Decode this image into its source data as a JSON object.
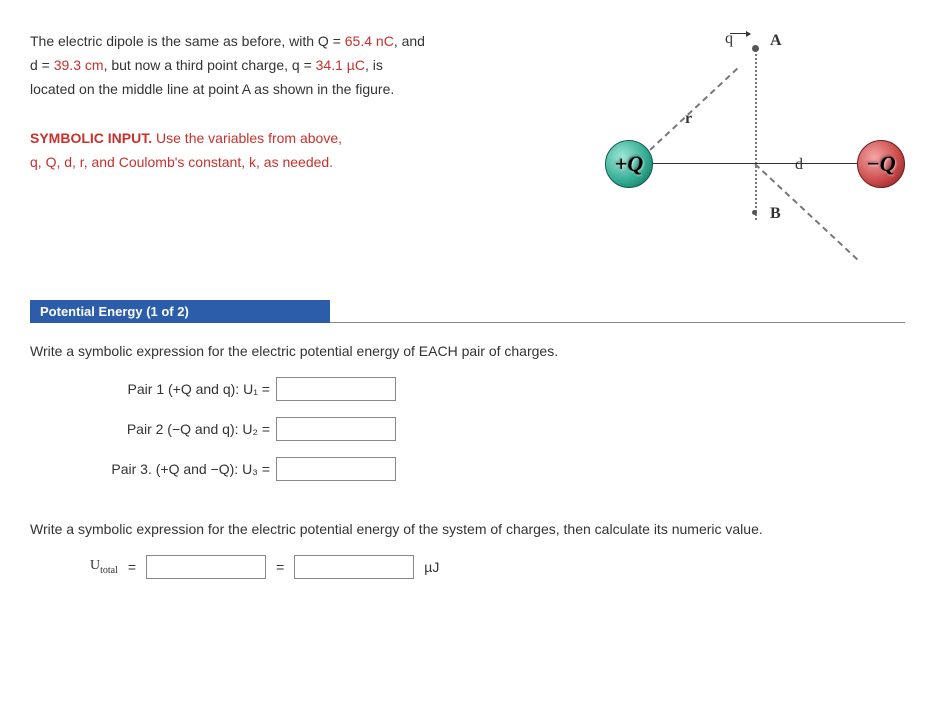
{
  "prose": {
    "intro1a": "The electric dipole is the same as before, with Q = ",
    "Q_val": "65.4 nC",
    "intro1b": ", and",
    "intro2a": "d = ",
    "d_val": "39.3 cm",
    "intro2b": ", but now a third point charge, q = ",
    "q_val": "34.1 µC",
    "intro2c": ", is",
    "intro3": "located on the middle line at point A as shown in the figure.",
    "sym1": "SYMBOLIC INPUT.",
    "sym2": " Use the variables from above,",
    "sym3": "q, Q, d, r, and Coulomb's constant, k, as needed."
  },
  "figure": {
    "q": "q",
    "A": "A",
    "r": "r",
    "d": "d",
    "B": "B",
    "posQ": "+Q",
    "negQ": "−Q"
  },
  "section": {
    "title": "Potential Energy (1 of 2)"
  },
  "prompt1": "Write a symbolic expression for the electric potential energy of EACH pair of charges.",
  "pairs": {
    "p1": "Pair 1 (+Q and q): U₁ =",
    "p2": "Pair 2 (−Q and q): U₂ =",
    "p3": "Pair 3. (+Q and −Q): U₃ ="
  },
  "prompt2": "Write a symbolic expression for the electric potential energy of the system of charges, then calculate its numeric value.",
  "total": {
    "label": "Utotal",
    "eq": "=",
    "unit": "µJ"
  }
}
